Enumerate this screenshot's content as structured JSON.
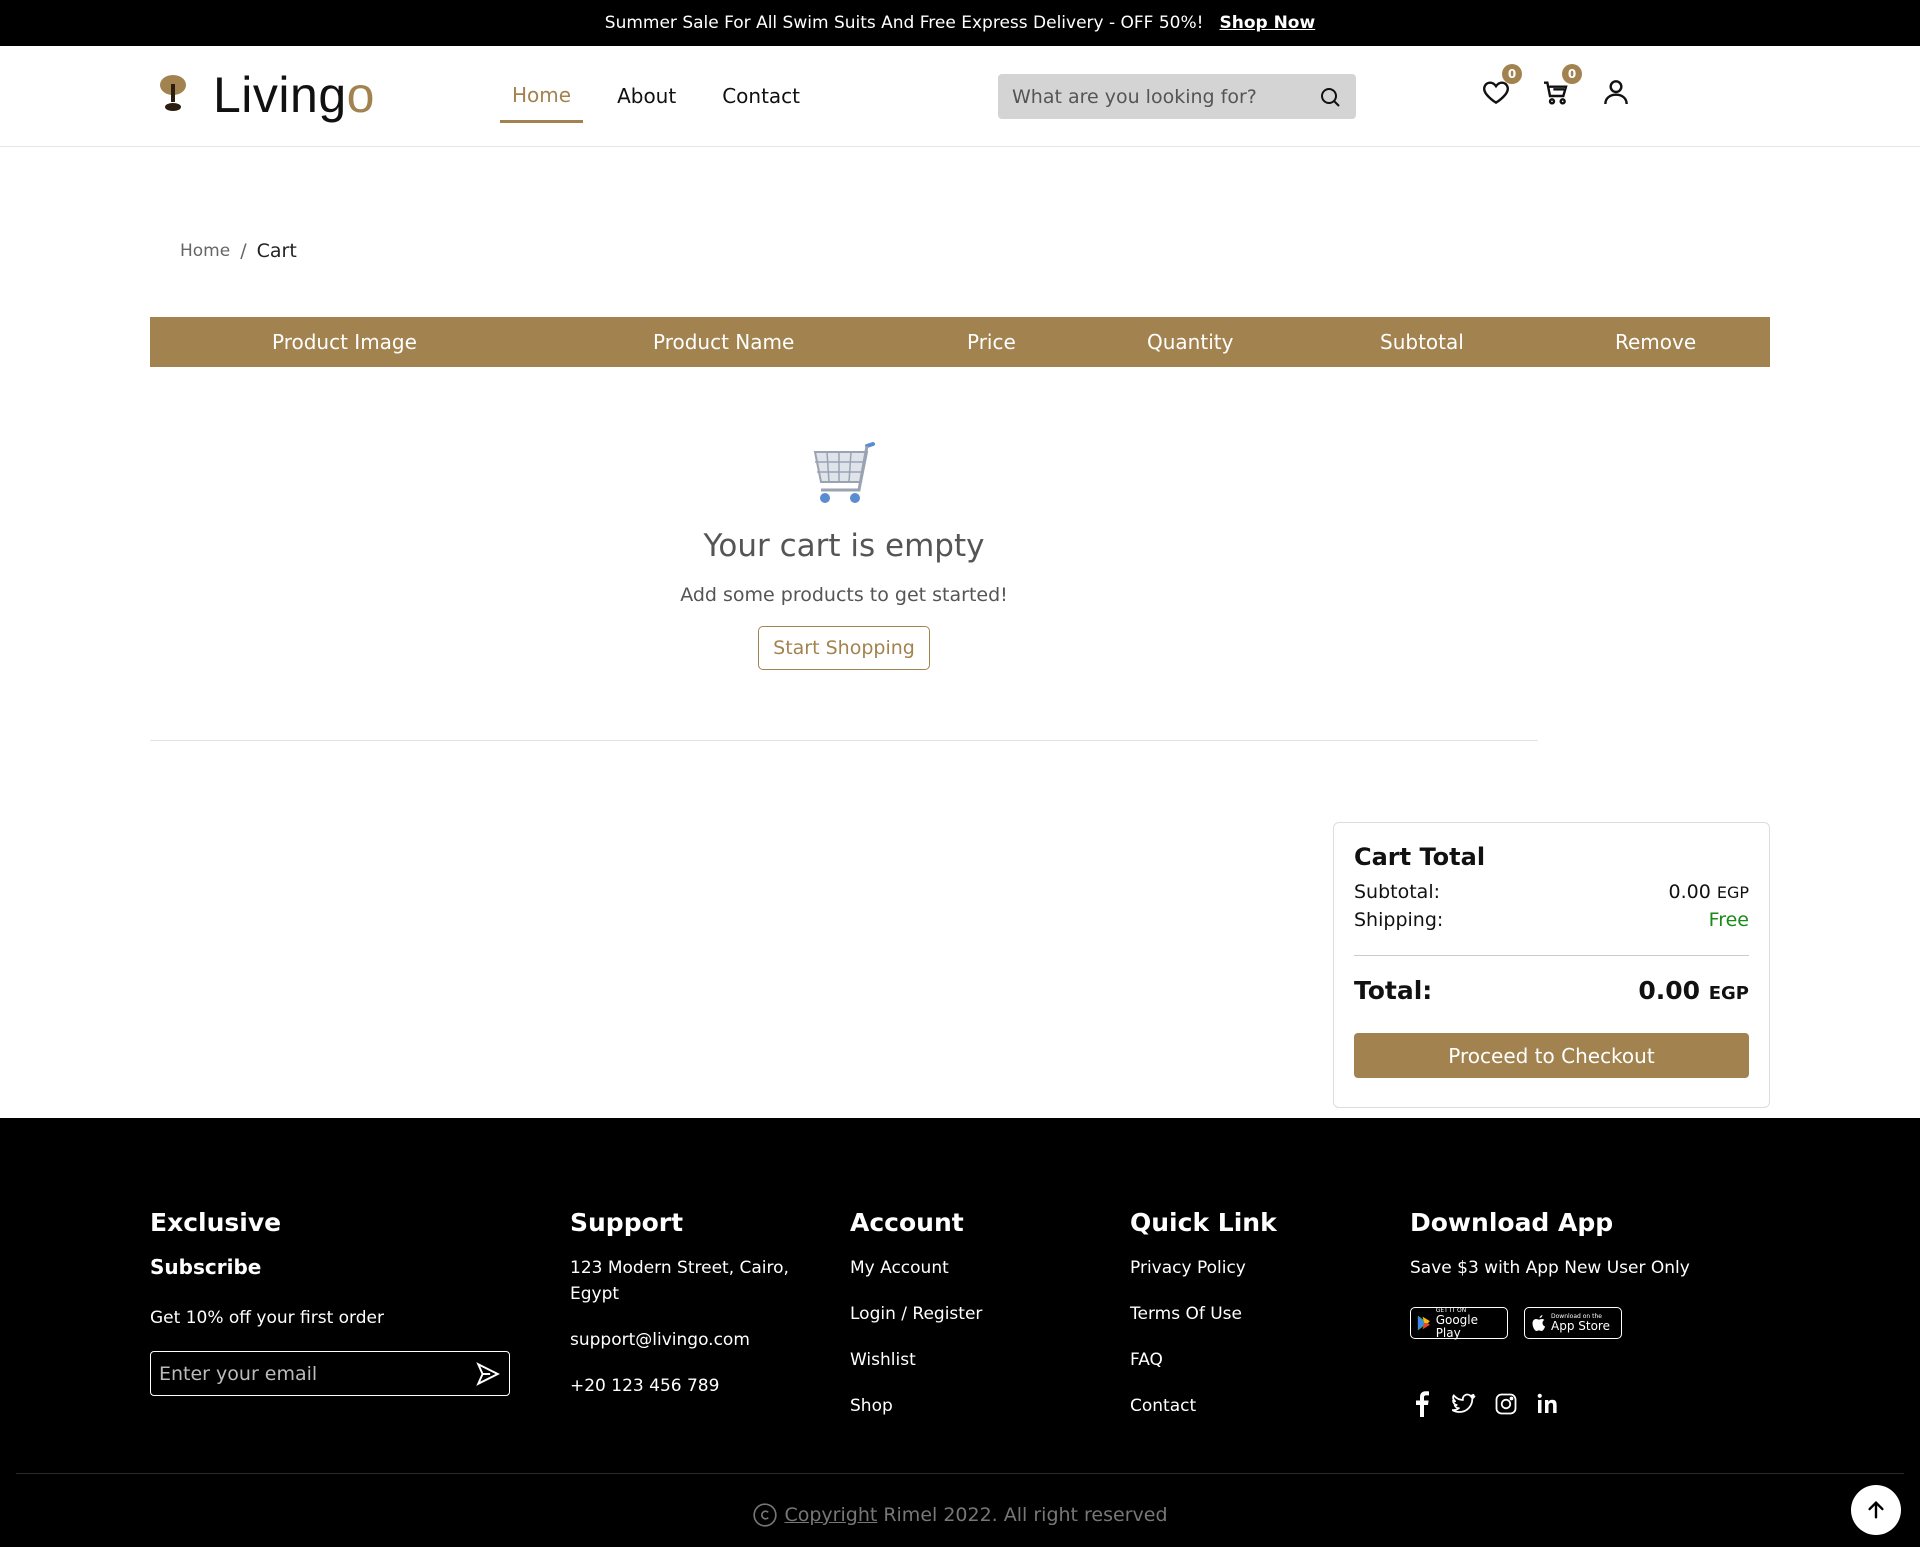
{
  "promo": {
    "text": "Summer Sale For All Swim Suits And Free Express Delivery - OFF 50%!",
    "link": "Shop Now"
  },
  "header": {
    "logo_main": "Living",
    "logo_accent": "o",
    "nav": [
      {
        "label": "Home",
        "active": true
      },
      {
        "label": "About",
        "active": false
      },
      {
        "label": "Contact",
        "active": false
      }
    ],
    "search_placeholder": "What are you looking for?",
    "wishlist_count": "0",
    "cart_count": "0"
  },
  "breadcrumb": {
    "home": "Home",
    "separator": "/",
    "current": "Cart"
  },
  "table": {
    "columns": [
      "Product Image",
      "Product Name",
      "Price",
      "Quantity",
      "Subtotal",
      "Remove"
    ]
  },
  "empty_cart": {
    "title": "Your cart is empty",
    "subtitle": "Add some products to get started!",
    "button": "Start Shopping"
  },
  "cart_total": {
    "title": "Cart Total",
    "subtotal_label": "Subtotal:",
    "subtotal_value": "0.00",
    "currency": "EGP",
    "shipping_label": "Shipping:",
    "shipping_value": "Free",
    "total_label": "Total:",
    "total_value": "0.00",
    "checkout": "Proceed to Checkout"
  },
  "footer": {
    "exclusive": {
      "title": "Exclusive",
      "subtitle": "Subscribe",
      "text": "Get 10% off your first order",
      "email_placeholder": "Enter your email"
    },
    "support": {
      "title": "Support",
      "address": "123 Modern Street, Cairo, Egypt",
      "email": "support@livingo.com",
      "phone": "+20 123 456 789"
    },
    "account": {
      "title": "Account",
      "links": [
        "My Account",
        "Login / Register",
        "Wishlist",
        "Shop"
      ]
    },
    "quick_link": {
      "title": "Quick Link",
      "links": [
        "Privacy Policy",
        "Terms Of Use",
        "FAQ",
        "Contact"
      ]
    },
    "download": {
      "title": "Download App",
      "text": "Save $3 with App New User Only",
      "google_small": "GET IT ON",
      "google_big": "Google Play",
      "apple_small": "Download on the",
      "apple_big": "App Store"
    },
    "copyright_link": "Copyright",
    "copyright_text": "Rimel 2022. All right reserved"
  },
  "colors": {
    "accent": "#a2834f",
    "shipping_free": "#1a8a1a",
    "footer_bg": "#000000"
  }
}
